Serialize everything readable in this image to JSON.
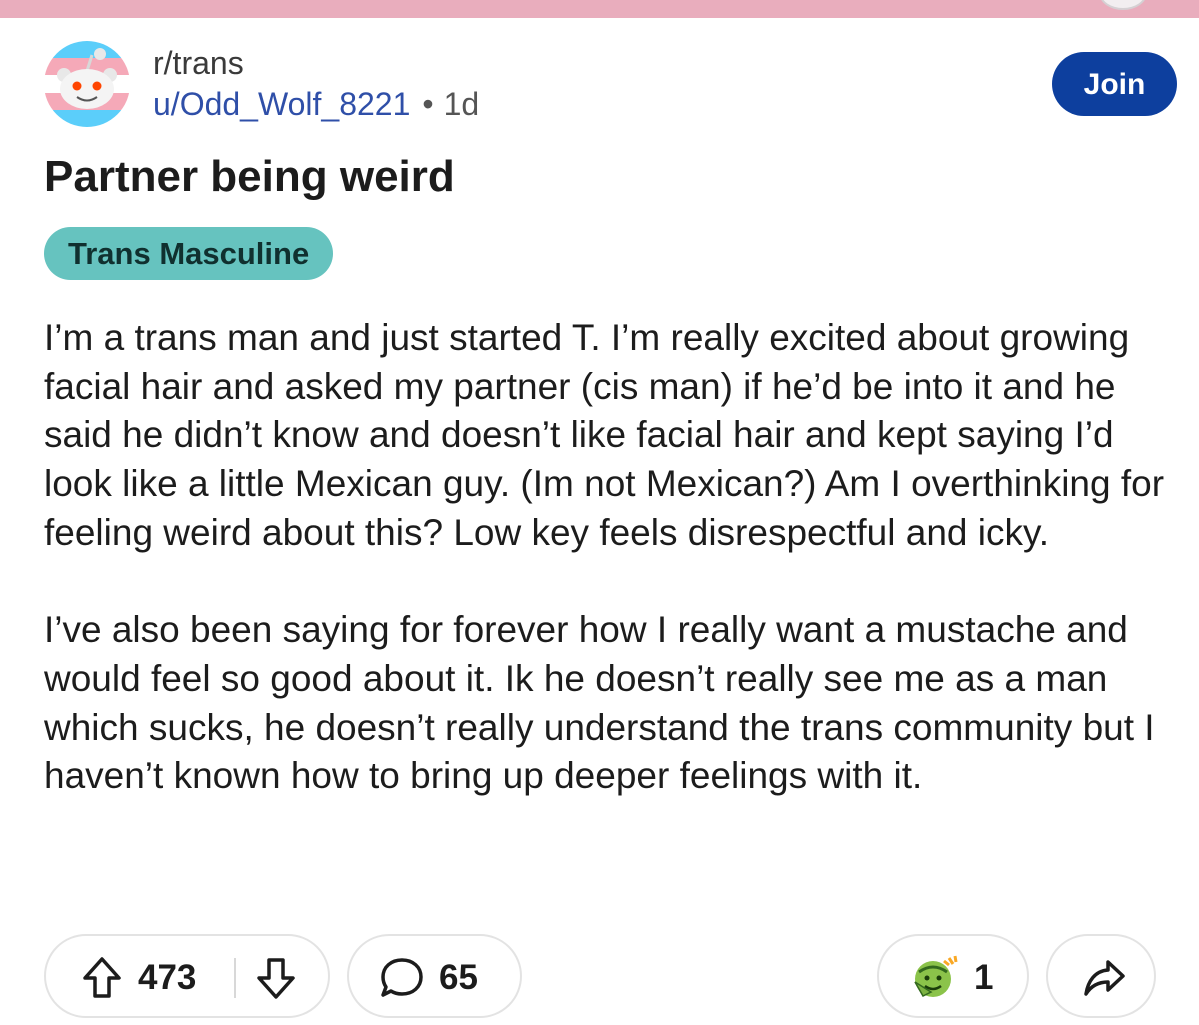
{
  "header": {
    "subreddit": "r/trans",
    "username": "u/Odd_Wolf_8221",
    "separator": "•",
    "age": "1d",
    "join_label": "Join"
  },
  "post": {
    "title": "Partner being weird",
    "flair": "Trans Masculine",
    "paragraphs": [
      "I’m a trans man and just started T. I’m really excited about growing facial hair and asked my partner (cis man)  if he’d be into it and he said he didn’t know and doesn’t like facial hair and kept saying I’d look like a little Mexican guy. (Im not Mexican?) Am I overthinking for feeling weird about this? Low key feels disrespectful and icky.",
      "I’ve also been saying for forever how I really want a mustache and would feel so good about it. Ik he doesn’t really see me as a man which sucks, he doesn’t really understand the trans community but I haven’t known how to bring up deeper feelings with it."
    ]
  },
  "actions": {
    "score": "473",
    "comments": "65",
    "awards": "1",
    "icons": [
      "upvote-icon",
      "downvote-icon",
      "comment-icon",
      "award-icon",
      "share-icon"
    ]
  },
  "colors": {
    "accent": "#0d3f9e",
    "flair_bg": "#66c3bf",
    "username": "#2f4fa8",
    "top_bar": "#e9adbd"
  }
}
